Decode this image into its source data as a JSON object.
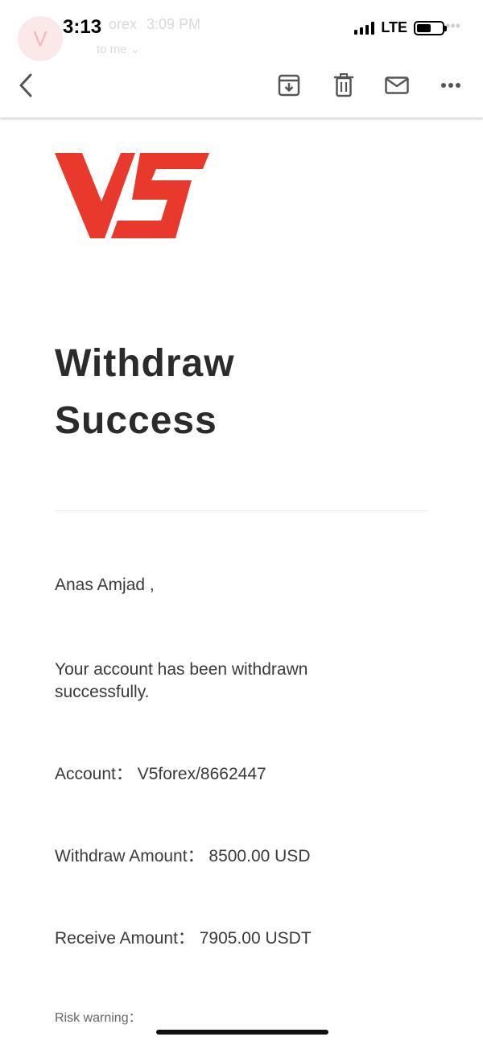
{
  "status_bar": {
    "time": "3:13",
    "network": "LTE"
  },
  "email_header": {
    "avatar_letter": "V",
    "sender": "orex",
    "sent_time": "3:09 PM",
    "recipient": "to me"
  },
  "toolbar": {
    "icons": [
      "back-chevron-icon",
      "archive-icon",
      "trash-icon",
      "mail-icon",
      "more-icon"
    ]
  },
  "email": {
    "brand_color": "#e8392c",
    "title_line1": "Withdraw",
    "title_line2": "Success",
    "greeting": "Anas Amjad ,",
    "message": "Your account has been withdrawn successfully.",
    "account_line": "Account： V5forex/8662447",
    "withdraw_line": "Withdraw Amount： 8500.00 USD",
    "receive_line": "Receive Amount： 7905.00 USDT",
    "risk_label": "Risk warning："
  }
}
